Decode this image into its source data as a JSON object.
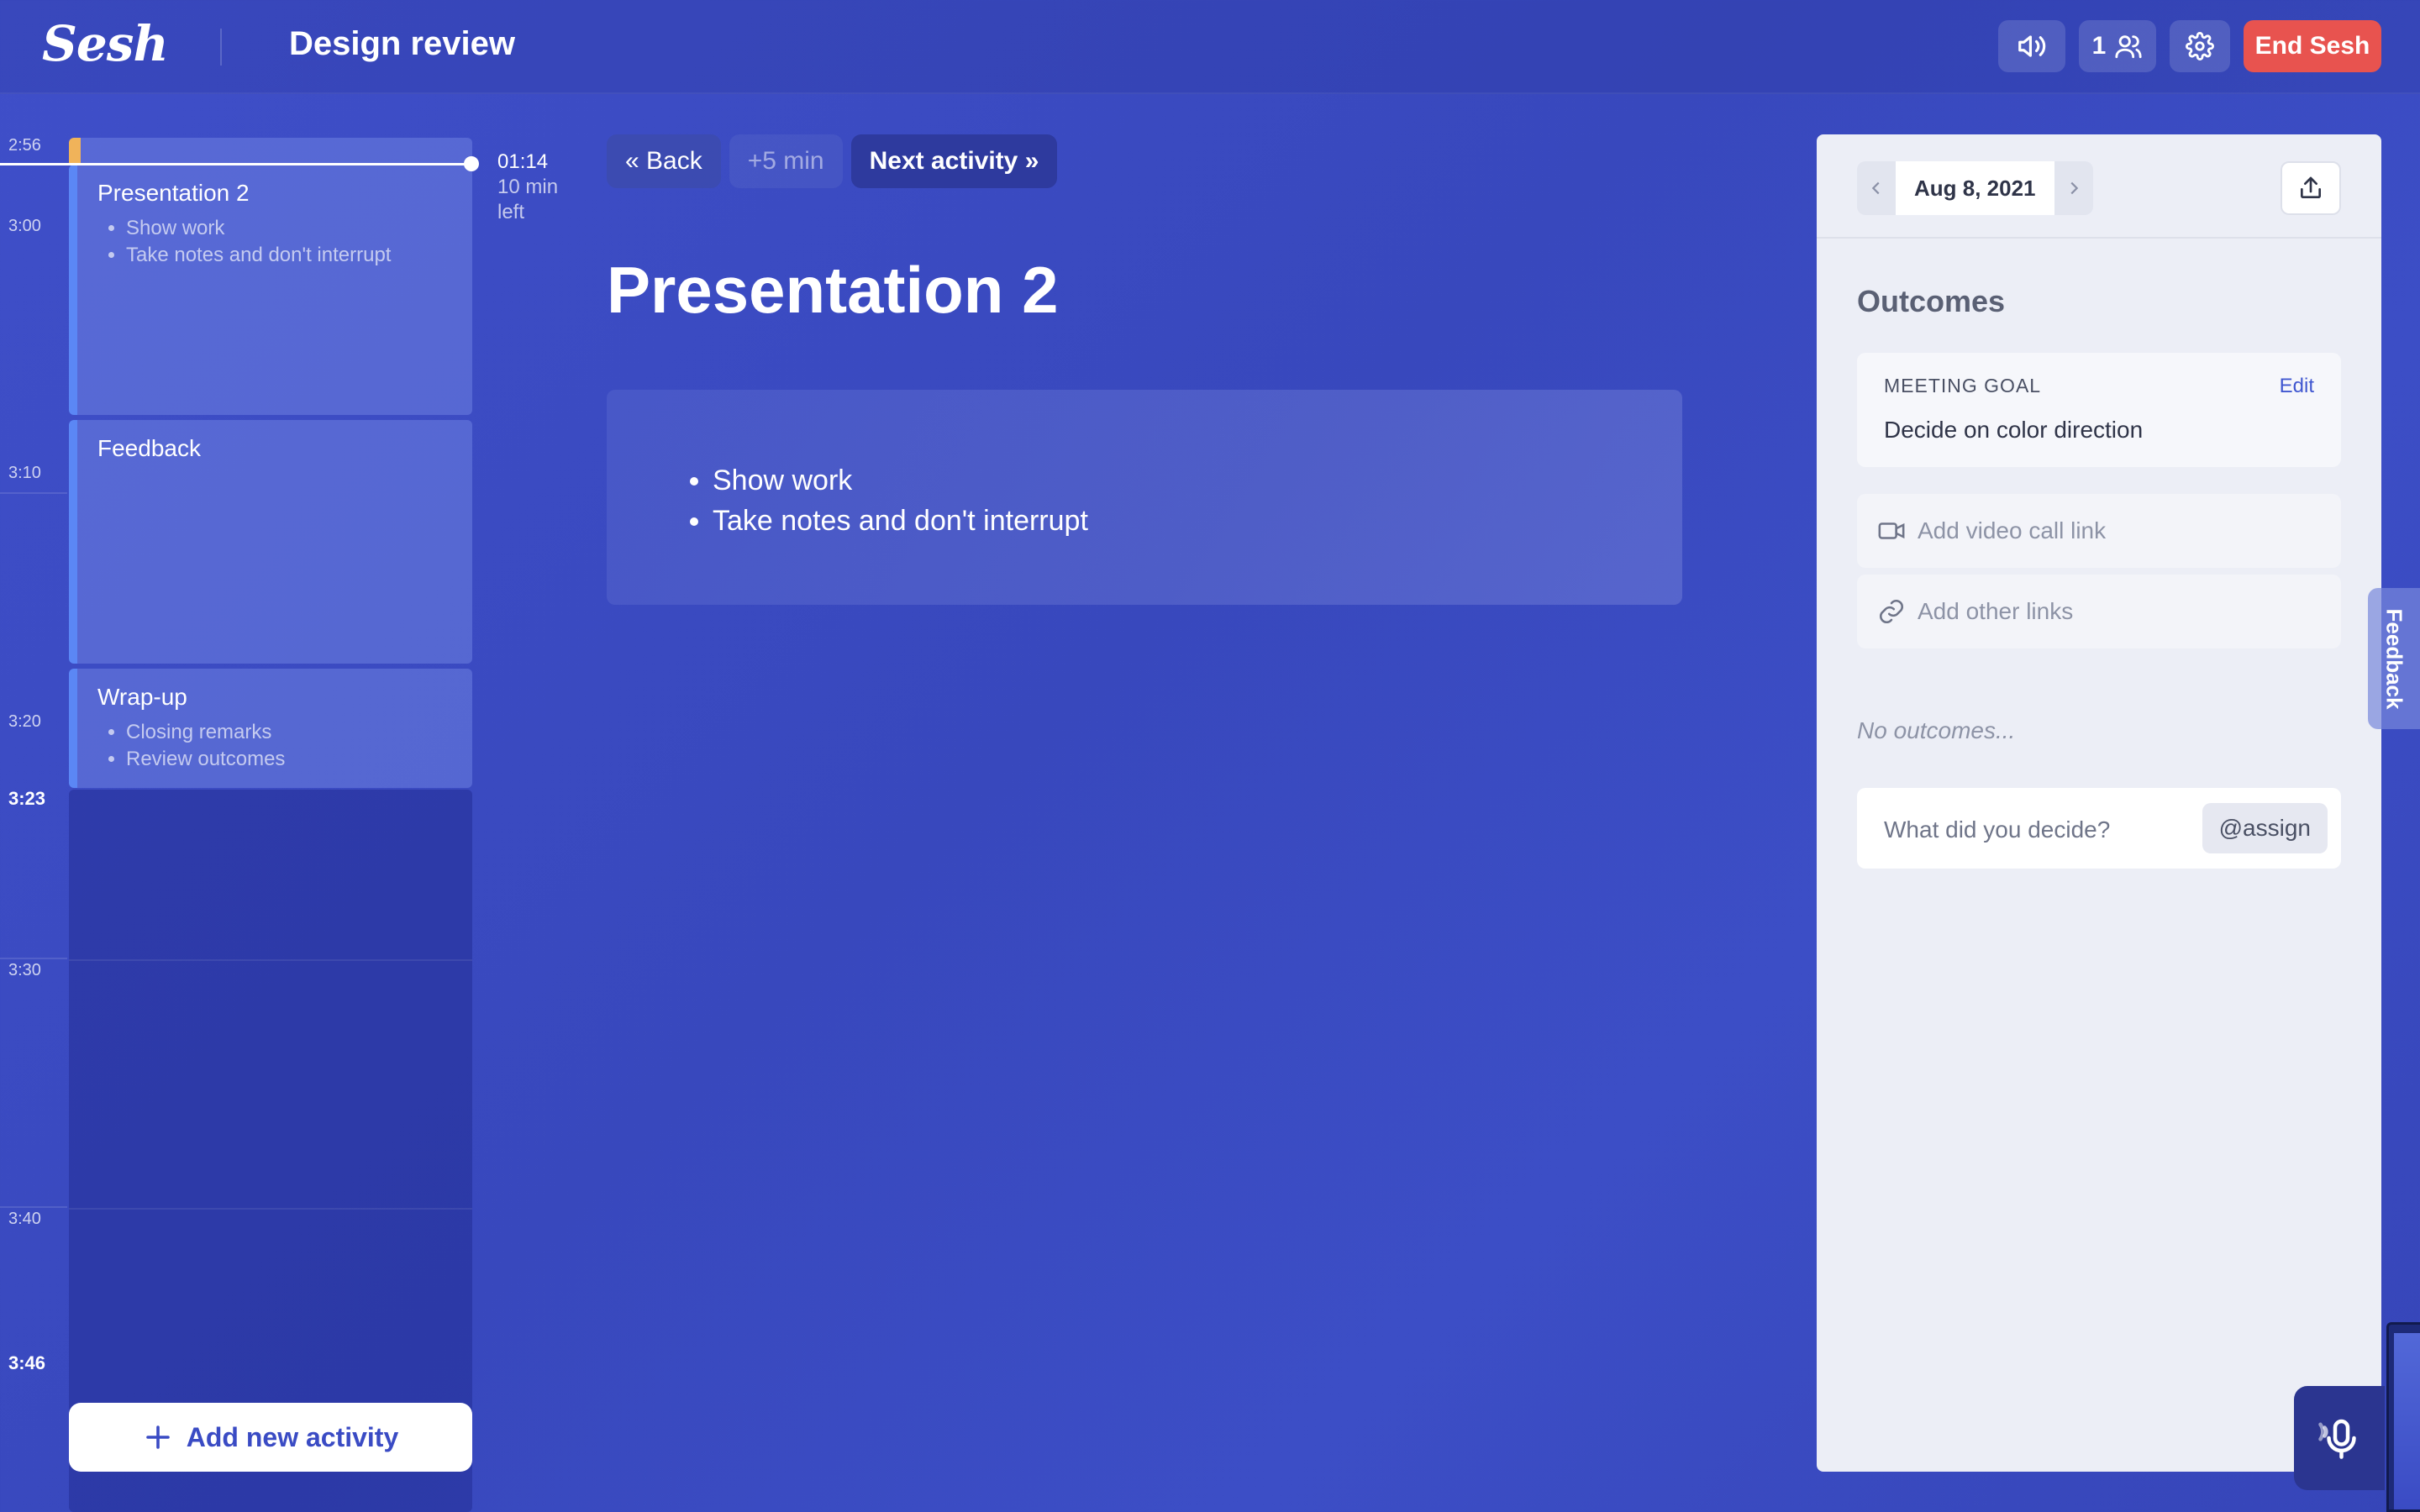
{
  "app": {
    "logo": "Sesh",
    "meeting_title": "Design review"
  },
  "topbar": {
    "participants_count": "1",
    "end_label": "End Sesh"
  },
  "timeline": {
    "labels": [
      "2:56",
      "3:00",
      "3:10",
      "3:20",
      "3:23",
      "3:30",
      "3:40",
      "3:46"
    ],
    "elapsed": "01:14",
    "time_left": "10 min",
    "time_left_suffix": "left",
    "activities": [
      {
        "title": "Presentation 2",
        "bullets": [
          "Show work",
          "Take notes and don't interrupt"
        ]
      },
      {
        "title": "Feedback",
        "bullets": []
      },
      {
        "title": "Wrap-up",
        "bullets": [
          "Closing remarks",
          "Review outcomes"
        ]
      }
    ],
    "add_label": "Add new activity"
  },
  "main": {
    "back_label": "« Back",
    "plus_label": "+5 min",
    "next_label": "Next activity »",
    "title": "Presentation 2",
    "notes": [
      "Show work",
      "Take notes and don't interrupt"
    ]
  },
  "panel": {
    "date": "Aug 8, 2021",
    "outcomes_title": "Outcomes",
    "goal_label": "MEETING GOAL",
    "goal_edit": "Edit",
    "goal_text": "Decide on color direction",
    "video_placeholder": "Add video call link",
    "links_placeholder": "Add other links",
    "no_outcomes": "No outcomes...",
    "decide_placeholder": "What did you decide?",
    "assign_label": "@assign"
  },
  "feedback_tab": "Feedback",
  "colors": {
    "accent": "#3a4bc4",
    "end_button": "#e8534f",
    "activity_bar": "#5b87f5"
  }
}
